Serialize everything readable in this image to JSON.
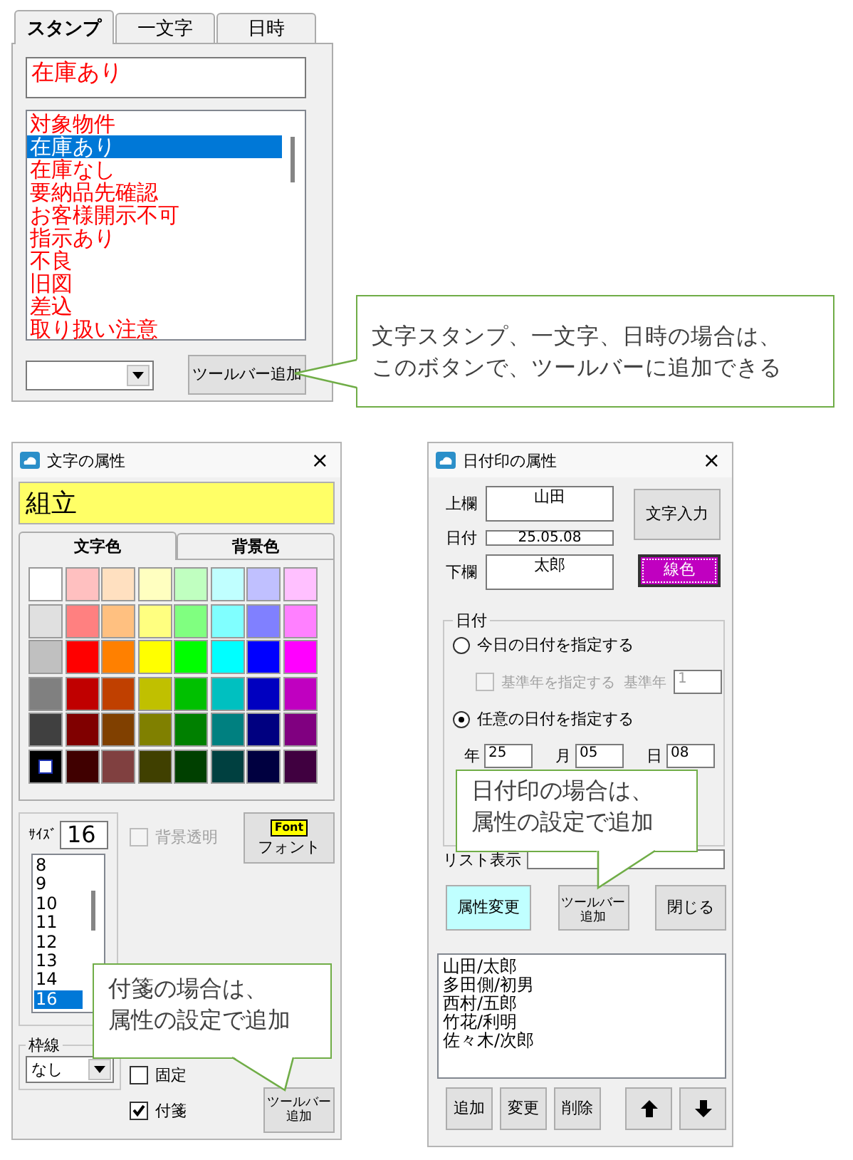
{
  "stamp_panel": {
    "tabs": [
      {
        "label": "スタンプ",
        "selected": true
      },
      {
        "label": "一文字",
        "selected": false
      },
      {
        "label": "日時",
        "selected": false
      }
    ],
    "text_field": {
      "value": "在庫あり"
    },
    "list": [
      {
        "label": "対象物件",
        "selected": false
      },
      {
        "label": "在庫あり",
        "selected": true
      },
      {
        "label": "在庫なし",
        "selected": false
      },
      {
        "label": "要納品先確認",
        "selected": false
      },
      {
        "label": "お客様開示不可",
        "selected": false
      },
      {
        "label": "指示あり",
        "selected": false
      },
      {
        "label": "不良",
        "selected": false
      },
      {
        "label": "旧図",
        "selected": false
      },
      {
        "label": "差込",
        "selected": false
      },
      {
        "label": "取り扱い注意",
        "selected": false
      }
    ],
    "toolbar_button": "ツールバー追加"
  },
  "stamp_callout": {
    "lines": [
      "文字スタンプ、一文字、日時の場合は、",
      "このボタンで、ツールバーに追加できる"
    ]
  },
  "text_dialog": {
    "title": "文字の属性",
    "close": "×",
    "text_field": {
      "value": "組立"
    },
    "tabs": [
      {
        "label": "文字色",
        "selected": true
      },
      {
        "label": "背景色",
        "selected": false
      }
    ],
    "palette": [
      {
        "swatches": [
          {
            "color": "#ffffff",
            "selected": false
          },
          {
            "color": "#ffc0c0",
            "selected": false
          },
          {
            "color": "#ffe0c0",
            "selected": false
          },
          {
            "color": "#ffffc0",
            "selected": false
          },
          {
            "color": "#c0ffc0",
            "selected": false
          },
          {
            "color": "#c0ffff",
            "selected": false
          },
          {
            "color": "#c0c0ff",
            "selected": false
          },
          {
            "color": "#ffc0ff",
            "selected": false
          }
        ]
      },
      {
        "swatches": [
          {
            "color": "#e0e0e0",
            "selected": false
          },
          {
            "color": "#ff8080",
            "selected": false
          },
          {
            "color": "#ffc080",
            "selected": false
          },
          {
            "color": "#ffff80",
            "selected": false
          },
          {
            "color": "#80ff80",
            "selected": false
          },
          {
            "color": "#80ffff",
            "selected": false
          },
          {
            "color": "#8080ff",
            "selected": false
          },
          {
            "color": "#ff80ff",
            "selected": false
          }
        ]
      },
      {
        "swatches": [
          {
            "color": "#c0c0c0",
            "selected": false
          },
          {
            "color": "#ff0000",
            "selected": false
          },
          {
            "color": "#ff8000",
            "selected": false
          },
          {
            "color": "#ffff00",
            "selected": false
          },
          {
            "color": "#00ff00",
            "selected": false
          },
          {
            "color": "#00ffff",
            "selected": false
          },
          {
            "color": "#0000ff",
            "selected": false
          },
          {
            "color": "#ff00ff",
            "selected": false
          }
        ]
      },
      {
        "swatches": [
          {
            "color": "#808080",
            "selected": false
          },
          {
            "color": "#c00000",
            "selected": false
          },
          {
            "color": "#c04000",
            "selected": false
          },
          {
            "color": "#c0c000",
            "selected": false
          },
          {
            "color": "#00c000",
            "selected": false
          },
          {
            "color": "#00c0c0",
            "selected": false
          },
          {
            "color": "#0000c0",
            "selected": false
          },
          {
            "color": "#c000c0",
            "selected": false
          }
        ]
      },
      {
        "swatches": [
          {
            "color": "#404040",
            "selected": false
          },
          {
            "color": "#800000",
            "selected": false
          },
          {
            "color": "#804000",
            "selected": false
          },
          {
            "color": "#808000",
            "selected": false
          },
          {
            "color": "#008000",
            "selected": false
          },
          {
            "color": "#008080",
            "selected": false
          },
          {
            "color": "#000080",
            "selected": false
          },
          {
            "color": "#800080",
            "selected": false
          }
        ]
      },
      {
        "swatches": [
          {
            "color": "#000000",
            "selected": true
          },
          {
            "color": "#400000",
            "selected": false
          },
          {
            "color": "#804040",
            "selected": false
          },
          {
            "color": "#404000",
            "selected": false
          },
          {
            "color": "#004000",
            "selected": false
          },
          {
            "color": "#004040",
            "selected": false
          },
          {
            "color": "#000040",
            "selected": false
          },
          {
            "color": "#400040",
            "selected": false
          }
        ]
      }
    ],
    "size": {
      "label": "ｻｲｽﾞ",
      "value": "16",
      "list": [
        {
          "label": "8",
          "selected": false
        },
        {
          "label": "9",
          "selected": false
        },
        {
          "label": "10",
          "selected": false
        },
        {
          "label": "11",
          "selected": false
        },
        {
          "label": "12",
          "selected": false
        },
        {
          "label": "13",
          "selected": false
        },
        {
          "label": "14",
          "selected": false
        },
        {
          "label": "16",
          "selected": true
        }
      ]
    },
    "transparent": {
      "label": "背景透明",
      "checked": false,
      "disabled": true
    },
    "font_button": {
      "badge": "Font",
      "label": "フォント"
    },
    "border": {
      "label": "枠線",
      "value": "なし"
    },
    "checkboxes": [
      {
        "label": "固定",
        "checked": false,
        "disabled": false
      },
      {
        "label": "付箋",
        "checked": true,
        "disabled": false
      }
    ],
    "toolbar_button": {
      "lines": [
        "ツールバー",
        "追加"
      ]
    },
    "callout": {
      "lines": [
        "付箋の場合は、",
        "属性の設定で追加"
      ]
    }
  },
  "date_dialog": {
    "title": "日付印の属性",
    "close": "×",
    "fields": [
      {
        "label": "上欄",
        "value": "山田",
        "kind": "tall"
      },
      {
        "label": "日付",
        "value": "25.05.08",
        "kind": "short"
      },
      {
        "label": "下欄",
        "value": "太郎",
        "kind": "tall"
      }
    ],
    "text_button": "文字入力",
    "line_color_button": {
      "label": "線色",
      "color": "#c000c0"
    },
    "date_group": {
      "label": "日付",
      "today": {
        "label": "今日の日付を指定する",
        "selected": false
      },
      "base_year_check": {
        "label": "基準年を指定する",
        "checked": false,
        "disabled": true
      },
      "base_year": {
        "label": "基準年",
        "value": "1",
        "disabled": true
      },
      "custom": {
        "label": "任意の日付を指定する",
        "selected": true
      },
      "parts": [
        {
          "label": "年",
          "value": "25"
        },
        {
          "label": "月",
          "value": "05"
        },
        {
          "label": "日",
          "value": "08"
        }
      ]
    },
    "list_display": {
      "label": "リスト表示"
    },
    "action_buttons": [
      {
        "lines": [
          "属性変更"
        ],
        "color": "#c0ffff"
      },
      {
        "lines": [
          "ツールバー",
          "追加"
        ]
      },
      {
        "lines": [
          "閉じる"
        ]
      }
    ],
    "names": [
      "山田/太郎",
      "多田側/初男",
      "西村/五郎",
      "竹花/利明",
      "佐々木/次郎"
    ],
    "list_buttons": [
      "追加",
      "変更",
      "削除"
    ],
    "callout": {
      "lines": [
        "日付印の場合は、",
        "属性の設定で追加"
      ]
    }
  }
}
